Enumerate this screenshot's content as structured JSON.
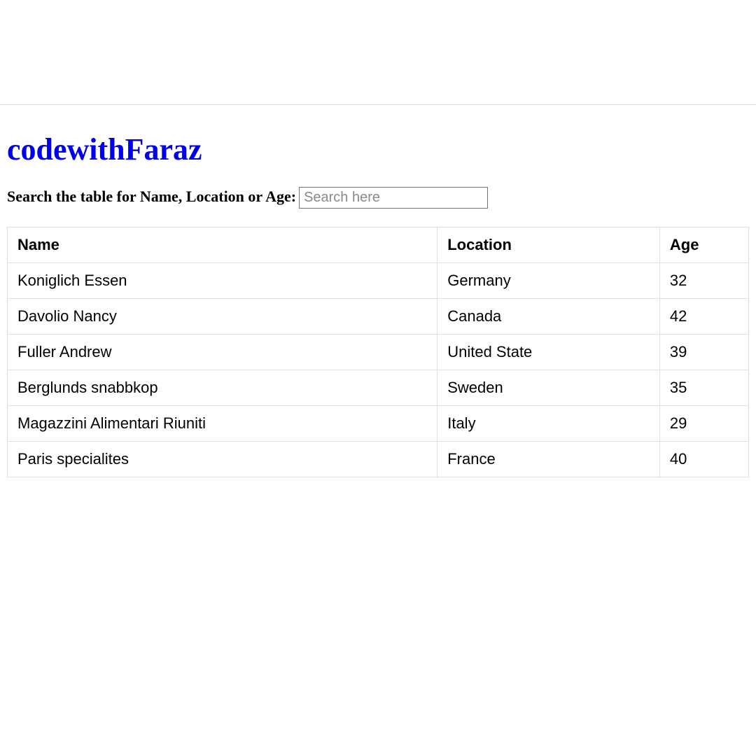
{
  "header": {
    "title": "codewithFaraz"
  },
  "search": {
    "label": "Search the table for Name, Location or Age:",
    "placeholder": "Search here",
    "value": ""
  },
  "table": {
    "columns": [
      "Name",
      "Location",
      "Age"
    ],
    "rows": [
      {
        "name": "Koniglich Essen",
        "location": "Germany",
        "age": "32"
      },
      {
        "name": "Davolio Nancy",
        "location": "Canada",
        "age": "42"
      },
      {
        "name": "Fuller Andrew",
        "location": "United State",
        "age": "39"
      },
      {
        "name": "Berglunds snabbkop",
        "location": "Sweden",
        "age": "35"
      },
      {
        "name": "Magazzini Alimentari Riuniti",
        "location": "Italy",
        "age": "29"
      },
      {
        "name": "Paris specialites",
        "location": "France",
        "age": "40"
      }
    ]
  }
}
